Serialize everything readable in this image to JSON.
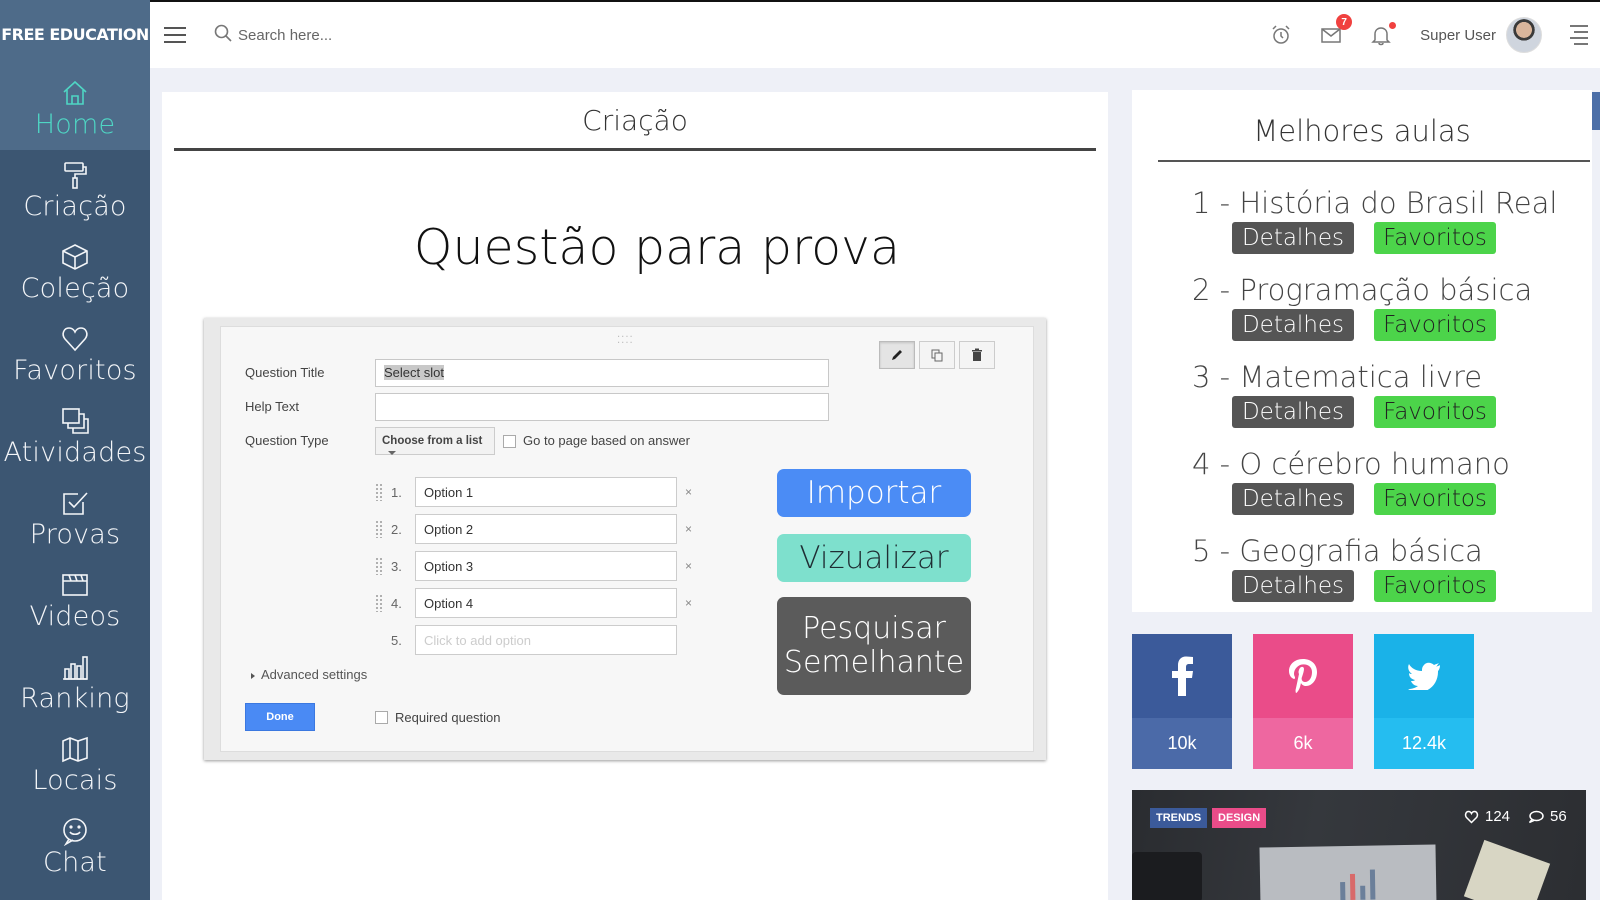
{
  "brand": "FREE EDUCATION",
  "sidebar": {
    "items": [
      {
        "label": "Home",
        "icon": "home-icon",
        "active": true
      },
      {
        "label": "Criação",
        "icon": "paint-roller-icon"
      },
      {
        "label": "Coleção",
        "icon": "cube-icon"
      },
      {
        "label": "Favoritos",
        "icon": "heart-icon"
      },
      {
        "label": "Atividades",
        "icon": "layers-icon"
      },
      {
        "label": "Provas",
        "icon": "checkbox-icon"
      },
      {
        "label": "Videos",
        "icon": "video-frame-icon"
      },
      {
        "label": "Ranking",
        "icon": "bar-chart-icon"
      },
      {
        "label": "Locais",
        "icon": "map-icon"
      },
      {
        "label": "Chat",
        "icon": "chat-icon"
      }
    ]
  },
  "topbar": {
    "search_placeholder": "Search here...",
    "mail_count": "7",
    "user_name": "Super User"
  },
  "main": {
    "title": "Criação",
    "heading": "Questão para prova",
    "form": {
      "question_title_label": "Question Title",
      "question_title_value": "Select slot",
      "help_text_label": "Help Text",
      "question_type_label": "Question Type",
      "question_type_value": "Choose from a list",
      "go_to_page_label": "Go to page based on answer",
      "options": [
        {
          "num": "1.",
          "text": "Option 1"
        },
        {
          "num": "2.",
          "text": "Option 2"
        },
        {
          "num": "3.",
          "text": "Option 3"
        },
        {
          "num": "4.",
          "text": "Option 4"
        }
      ],
      "add_option_num": "5.",
      "add_option_placeholder": "Click to add option",
      "advanced_label": "Advanced settings",
      "done_label": "Done",
      "required_label": "Required question",
      "remove_symbol": "×"
    },
    "actions": {
      "import": "Importar",
      "view": "Vizualizar",
      "search_line1": "Pesquisar",
      "search_line2": "Semelhante"
    }
  },
  "best": {
    "title": "Melhores aulas",
    "details_label": "Detalhes",
    "favorite_label": "Favoritos",
    "lessons": [
      "1 - História do Brasil Real",
      "2 - Programação básica",
      "3 - Matematica livre",
      "4 - O cérebro humano",
      "5 - Geografia básica"
    ]
  },
  "social": {
    "facebook": "10k",
    "pinterest": "6k",
    "twitter": "12.4k"
  },
  "blog": {
    "tags": [
      "TRENDS",
      "DESIGN"
    ],
    "likes": "124",
    "comments": "56"
  },
  "colors": {
    "sidebar": "#3c5672",
    "active": "#4fd6c4",
    "import": "#4b8cf5",
    "view": "#7ee0cd",
    "favorite": "#4cd44a"
  }
}
